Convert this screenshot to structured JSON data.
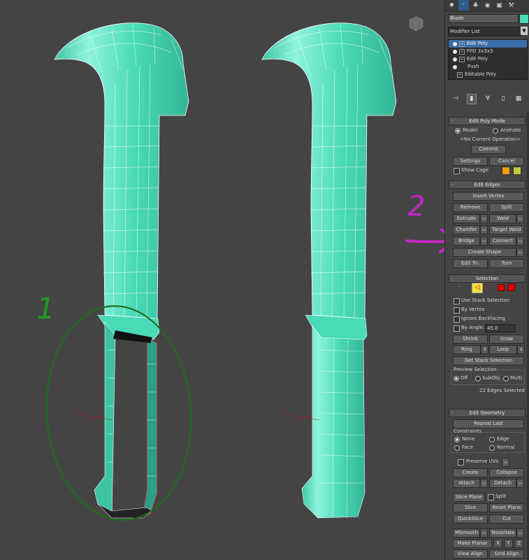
{
  "viewport": {
    "annotations": {
      "one": "1",
      "two": "2"
    },
    "colors": {
      "mesh": "#49dab8",
      "annotation_green": "#1c6e1c",
      "annotation_purple": "#c228c2",
      "selected_edge": "#e03030"
    }
  },
  "panel": {
    "tabs": [
      "create-icon",
      "modify-icon",
      "hierarchy-icon",
      "motion-icon",
      "display-icon",
      "utilities-icon"
    ],
    "object_name": "Blade",
    "object_color": "#49dab8",
    "modifier_list": "Modifier List",
    "stack": [
      {
        "label": "Edit Poly",
        "selected": true
      },
      {
        "label": "FFD 3x3x3",
        "selected": false
      },
      {
        "label": "Edit Poly",
        "selected": false
      },
      {
        "label": "Push",
        "selected": false
      },
      {
        "label": "Editable Poly",
        "selected": false
      }
    ],
    "edit_poly_mode": {
      "title": "Edit Poly Mode",
      "model": "Model",
      "animate": "Animate",
      "current_op": "<No Current Operation>",
      "commit": "Commit",
      "settings": "Settings",
      "cancel": "Cancel",
      "show_cage": "Show Cage",
      "cage_color1": "#f39c12",
      "cage_color2": "#c8c83c"
    },
    "edit_edges": {
      "title": "Edit Edges",
      "insert_vertex": "Insert Vertex",
      "remove": "Remove",
      "split": "Split",
      "extrude": "Extrude",
      "weld": "Weld",
      "chamfer": "Chamfer",
      "target_weld": "Target Weld",
      "bridge": "Bridge",
      "connect": "Connect",
      "create_shape": "Create Shape",
      "edit_tri": "Edit Tri.",
      "turn": "Turn"
    },
    "selection": {
      "title": "Selection",
      "use_stack": "Use Stack Selection",
      "by_vertex": "By Vertex",
      "ignore_backfacing": "Ignore Backfacing",
      "by_angle": "By Angle:",
      "angle_value": "45.0",
      "shrink": "Shrink",
      "grow": "Grow",
      "ring": "Ring",
      "loop": "Loop",
      "get_stack": "Get Stack Selection",
      "preview_title": "Preview Selection",
      "off": "Off",
      "subobj": "SubObj",
      "multi": "Multi",
      "status": "22 Edges Selected"
    },
    "edit_geometry": {
      "title": "Edit Geometry",
      "repeat_last": "Repeat Last",
      "constraints": "Constraints",
      "none": "None",
      "edge": "Edge",
      "face": "Face",
      "normal": "Normal",
      "preserve_uvs": "Preserve UVs",
      "create": "Create",
      "collapse": "Collapse",
      "attach": "Attach",
      "detach": "Detach",
      "slice_plane": "Slice Plane",
      "split": "Split",
      "slice": "Slice",
      "reset_plane": "Reset Plane",
      "quickslice": "QuickSlice",
      "cut": "Cut",
      "msmooth": "MSmooth",
      "tessellate": "Tessellate",
      "make_planar": "Make Planar",
      "x": "X",
      "y": "Y",
      "z": "Z",
      "view_align": "View Align",
      "grid_align": "Grid Align"
    }
  }
}
